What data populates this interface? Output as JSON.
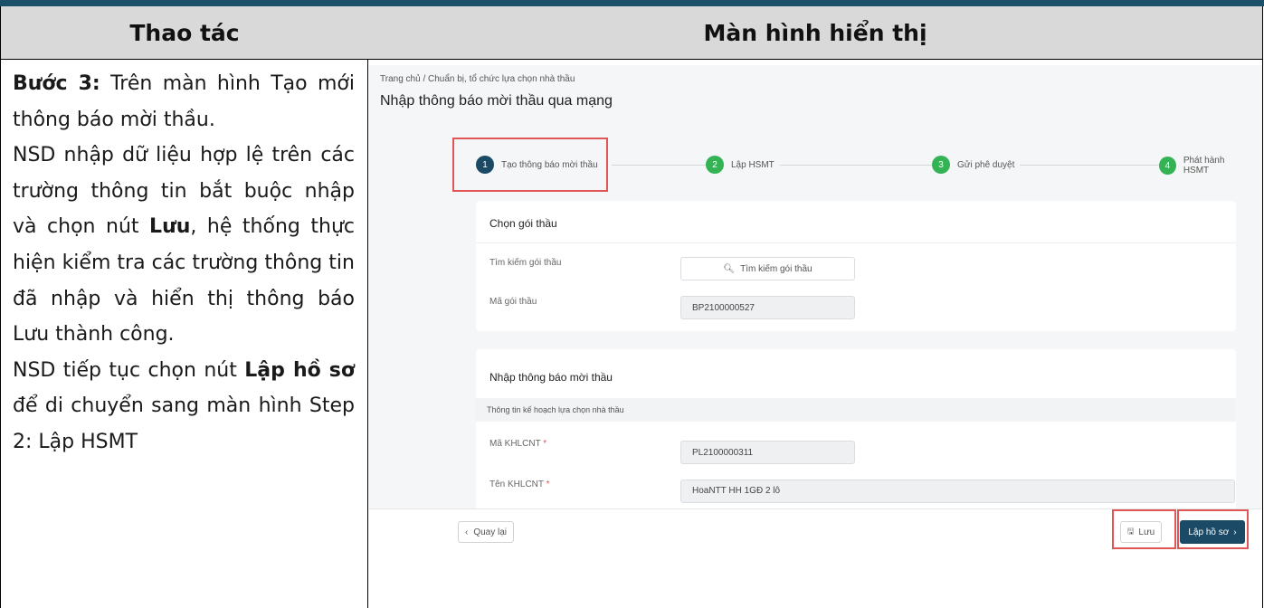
{
  "table": {
    "col1_header": "Thao tác",
    "col2_header": "Màn hình hiển thị"
  },
  "instruction": {
    "step_label": "Bước 3:",
    "text1": " Trên màn hình Tạo mới thông báo mời thầu.",
    "text2": "NSD nhập dữ liệu hợp lệ trên các trường thông tin bắt buộc nhập và chọn nút ",
    "save_bold": "Lưu",
    "text3": ", hệ thống thực hiện kiểm tra các trường thông tin đã nhập và hiển thị thông báo Lưu thành công.",
    "text4": "NSD tiếp tục chọn nút ",
    "create_bold": "Lập hồ sơ",
    "text5": " để di chuyển sang màn hình Step 2: Lập HSMT"
  },
  "screen": {
    "breadcrumb": [
      "Trang chủ",
      "/",
      "Chuẩn bị, tổ chức lựa chọn nhà thầu"
    ],
    "title": "Nhập thông báo mời thầu qua mạng",
    "steps": [
      {
        "num": "1",
        "label": "Tạo thông báo mời thầu"
      },
      {
        "num": "2",
        "label": "Lập HSMT"
      },
      {
        "num": "3",
        "label": "Gửi phê duyệt"
      },
      {
        "num": "4",
        "label": "Phát hành HSMT"
      }
    ],
    "select_package": {
      "title": "Chọn gói thầu",
      "search_label": "Tìm kiếm gói thầu",
      "search_button": "Tìm kiếm gói thầu",
      "code_label": "Mã gói thầu",
      "code_value": "BP2100000527"
    },
    "notice": {
      "title": "Nhập thông báo mời thầu",
      "subhead": "Thông tin kế hoạch lựa chọn nhà thầu",
      "plan_code_label": "Mã KHLCNT",
      "plan_code_value": "PL2100000311",
      "plan_name_label": "Tên KHLCNT",
      "plan_name_value": "HoaNTT HH 1GĐ 2 lô",
      "required_mark": "*"
    },
    "footer": {
      "back": "Quay lại",
      "save": "Lưu",
      "next": "Lập hồ sơ"
    }
  },
  "colors": {
    "header_bg": "#d9d9d9",
    "primary": "#1b4a67",
    "step_green": "#34b354",
    "highlight": "#e05555"
  }
}
